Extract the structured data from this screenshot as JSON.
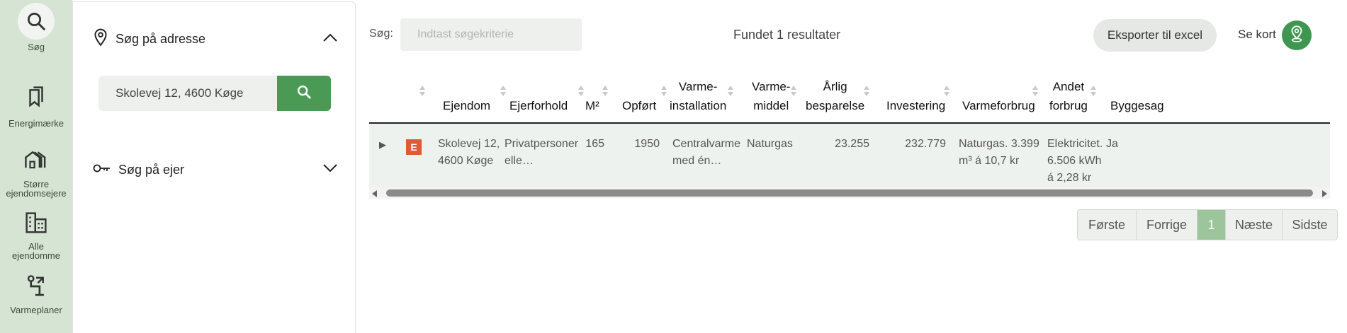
{
  "rail": {
    "items": [
      {
        "label": "Søg",
        "icon": "search-icon",
        "active": true
      },
      {
        "label": "Energimærke",
        "icon": "bookmarks-icon"
      },
      {
        "label_line1": "Større",
        "label_line2": "ejendomsejere",
        "icon": "buildings-icon"
      },
      {
        "label_line1": "Alle",
        "label_line2": "ejendomme",
        "icon": "city-icon"
      },
      {
        "label": "Varmeplaner",
        "icon": "heat-plan-icon"
      }
    ]
  },
  "panel": {
    "address_title": "Søg på adresse",
    "address_value": "Skolevej 12, 4600 Køge",
    "owner_title": "Søg på ejer"
  },
  "toolbar": {
    "search_label": "Søg:",
    "search_placeholder": "Indtast søgekriterie",
    "results": "Fundet 1 resultater",
    "export_label": "Eksporter til excel",
    "map_label": "Se kort"
  },
  "table": {
    "headers": {
      "ejendom": "Ejendom",
      "ejerforhold": "Ejerforhold",
      "m2": "M²",
      "opfort": "Opført",
      "varmeinst_1": "Varme-",
      "varmeinst_2": "installation",
      "varmemiddel_1": "Varme-",
      "varmemiddel_2": "middel",
      "besparelse_1": "Årlig",
      "besparelse_2": "besparelse",
      "investering": "Investering",
      "varmeforbrug": "Varmeforbrug",
      "andet_1": "Andet",
      "andet_2": "forbrug",
      "byggesag": "Byggesag"
    },
    "row": {
      "badge": "E",
      "ejendom_1": "Skolevej 12,",
      "ejendom_2": "4600 Køge",
      "ejerforhold_1": "Privatpersoner",
      "ejerforhold_2": "elle…",
      "m2": "165",
      "opfort": "1950",
      "varmeinst_1": "Centralvarme",
      "varmeinst_2": "med én…",
      "varmemiddel": "Naturgas",
      "besparelse": "23.255",
      "investering": "232.779",
      "varmeforbrug_1": "Naturgas. 3.399",
      "varmeforbrug_2": "m³ á 10,7 kr",
      "andet_1": "Elektricitet.",
      "andet_2": "6.506 kWh",
      "andet_3": "á 2,28 kr",
      "byggesag": "Ja"
    }
  },
  "pager": {
    "first": "Første",
    "prev": "Forrige",
    "current": "1",
    "next": "Næste",
    "last": "Sidste"
  },
  "colors": {
    "rail_bg": "#d6e4d4",
    "accent": "#4a9a55",
    "energy_label_e": "#e05a33",
    "pager_active": "#9cc59c"
  }
}
